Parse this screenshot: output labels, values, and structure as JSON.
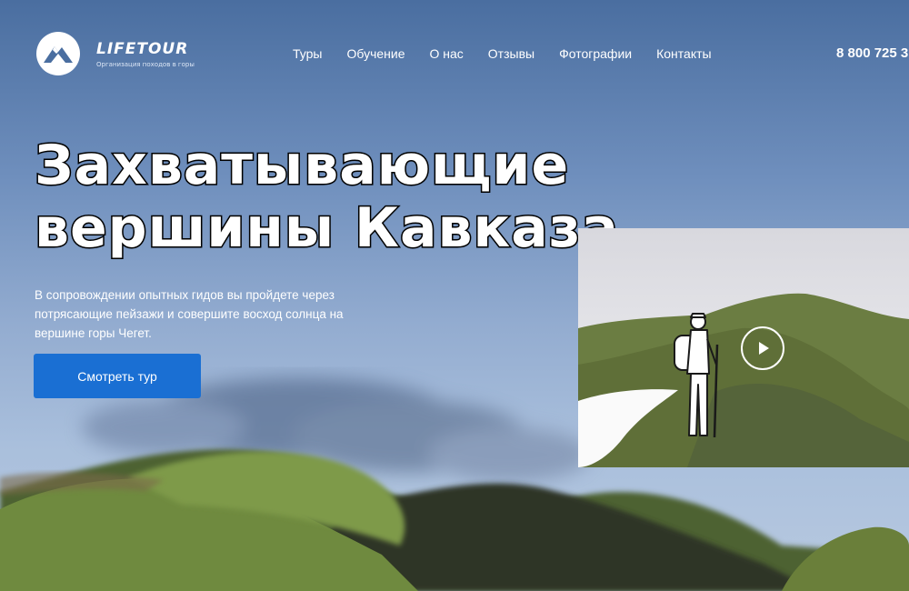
{
  "logo": {
    "name": "LIFETOUR",
    "tagline": "Организация походов в горы"
  },
  "nav": {
    "items": [
      "Туры",
      "Обучение",
      "О нас",
      "Отзывы",
      "Фотографии",
      "Контакты"
    ]
  },
  "phone": "8 800 725 3",
  "hero": {
    "title_line1": "Захватывающие",
    "title_line2": "вершины Кавказа",
    "description": "В сопровождении опытных гидов вы пройдете через потрясающие пейзажи и совершите восход солнца на вершине горы Чегет.",
    "cta_label": "Смотреть тур"
  },
  "colors": {
    "accent": "#1a6fd3",
    "sky": "#6f8fbd",
    "hill_green": "#6f8a3f"
  },
  "icons": {
    "logo": "mountain-logo-icon",
    "play": "play-icon"
  }
}
